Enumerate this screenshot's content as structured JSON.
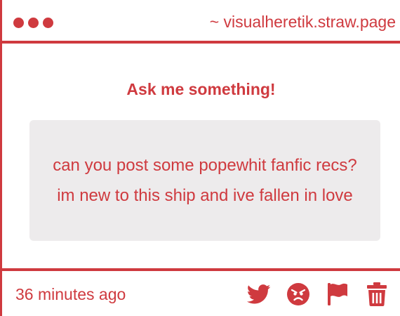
{
  "window": {
    "url": "~ visualheretik.straw.page"
  },
  "main": {
    "heading": "Ask me something!",
    "question": "can you post some popewhit fanfic recs? im new to this ship and ive fallen in love"
  },
  "footer": {
    "timestamp": "36 minutes ago",
    "actions": [
      {
        "icon": "twitter-icon"
      },
      {
        "icon": "angry-face-icon"
      },
      {
        "icon": "flag-icon"
      },
      {
        "icon": "trash-icon"
      }
    ]
  },
  "colors": {
    "accent": "#cf3a3f",
    "question_bg": "#edebec",
    "background": "#ffffff"
  }
}
